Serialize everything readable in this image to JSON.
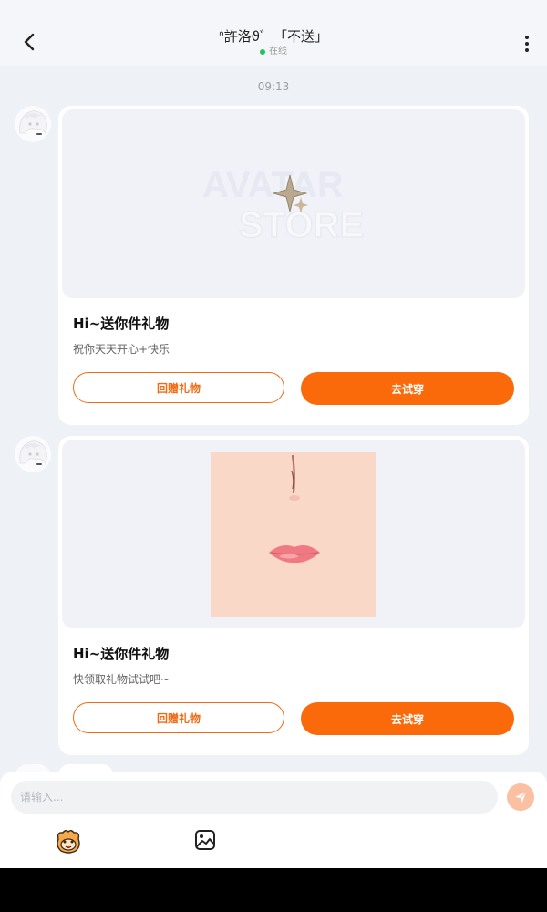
{
  "header": {
    "title": "ᐢ許洛ϑ゛「不送」",
    "status": "在线",
    "back_icon": "chevron-left-icon",
    "more_icon": "more-vertical-icon"
  },
  "chat": {
    "timestamp": "09:13",
    "messages": [
      {
        "title": "Hi~送你件礼物",
        "subtitle": "祝你天天开心+快乐",
        "return_label": "回赠礼物",
        "try_label": "去试穿",
        "logo_line1": "AVATAR",
        "logo_line2": "STORE"
      },
      {
        "title": "Hi~送你件礼物",
        "subtitle": "快领取礼物试试吧~",
        "return_label": "回赠礼物",
        "try_label": "去试穿"
      }
    ]
  },
  "composer": {
    "placeholder": "请输入...",
    "send_icon": "send-icon",
    "emoji_icon": "emoji-face-icon",
    "image_icon": "image-icon"
  },
  "colors": {
    "accent": "#fa6a0a",
    "online": "#22c35e",
    "background": "#eef1f6"
  }
}
